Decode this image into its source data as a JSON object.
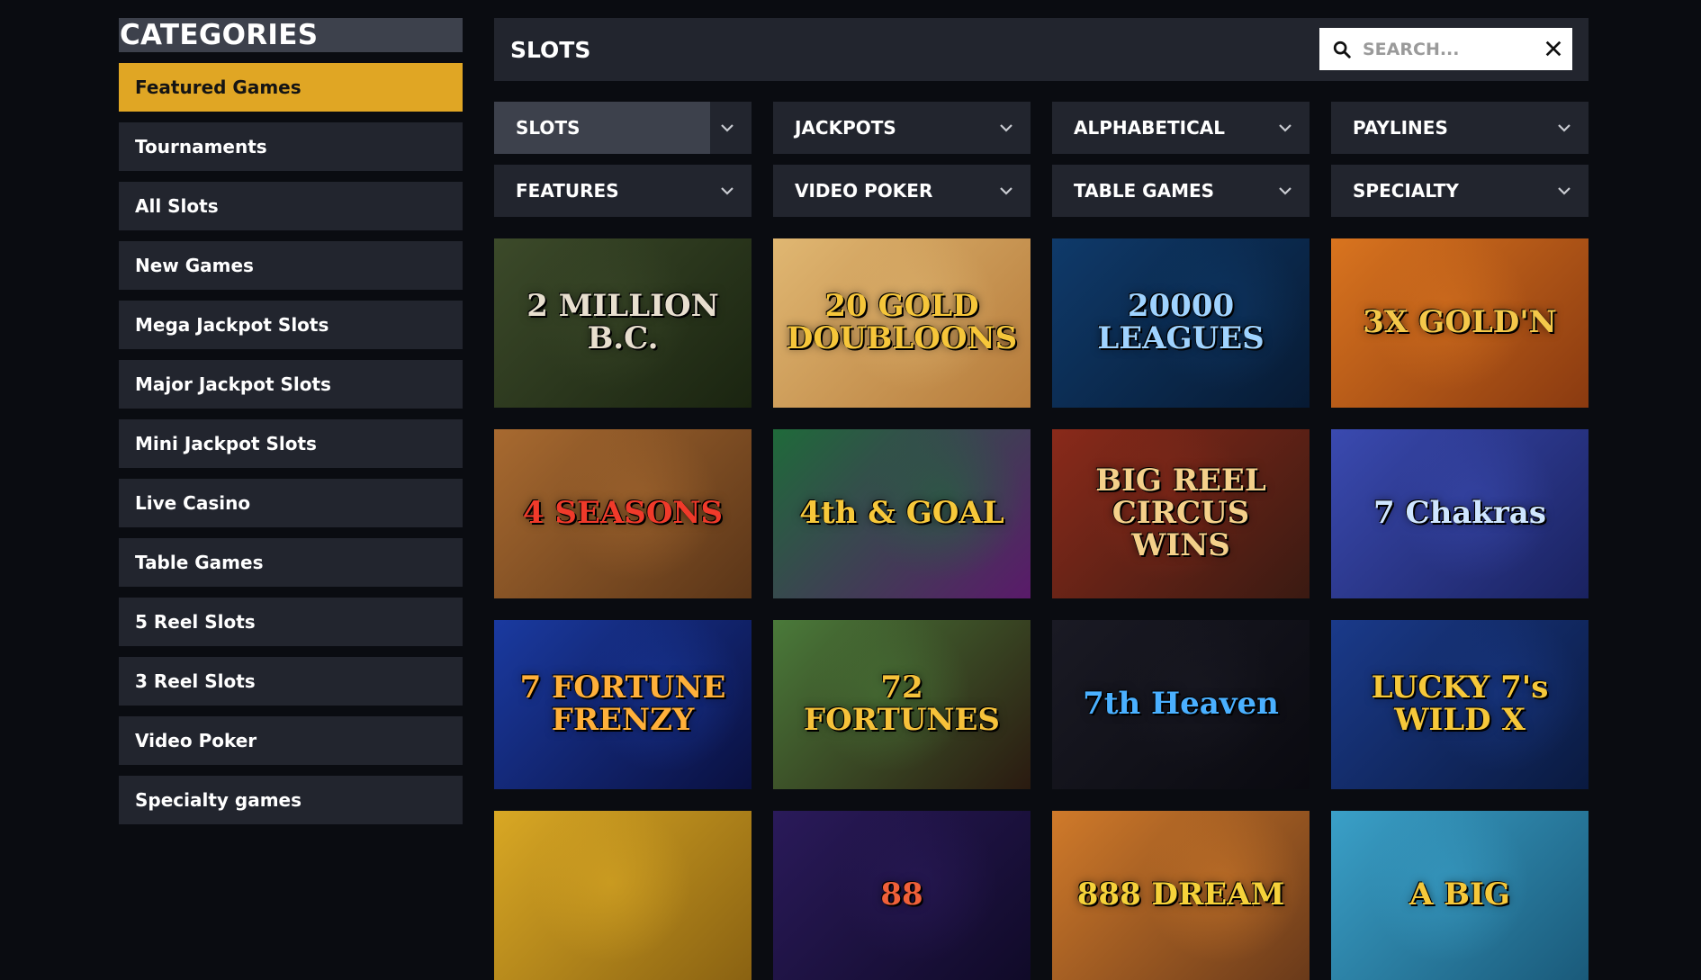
{
  "sidebar": {
    "title": "CATEGORIES",
    "items": [
      {
        "label": "Featured Games",
        "active": true
      },
      {
        "label": "Tournaments"
      },
      {
        "label": "All Slots"
      },
      {
        "label": "New Games"
      },
      {
        "label": "Mega Jackpot Slots"
      },
      {
        "label": "Major Jackpot Slots"
      },
      {
        "label": "Mini Jackpot Slots"
      },
      {
        "label": "Live Casino"
      },
      {
        "label": "Table Games"
      },
      {
        "label": "5 Reel Slots"
      },
      {
        "label": "3 Reel Slots"
      },
      {
        "label": "Video Poker"
      },
      {
        "label": "Specialty games"
      }
    ]
  },
  "header": {
    "title": "SLOTS",
    "search_placeholder": "SEARCH..."
  },
  "filters": [
    {
      "label": "SLOTS",
      "active": true
    },
    {
      "label": "JACKPOTS"
    },
    {
      "label": "ALPHABETICAL"
    },
    {
      "label": "PAYLINES"
    },
    {
      "label": "FEATURES"
    },
    {
      "label": "VIDEO POKER"
    },
    {
      "label": "TABLE GAMES"
    },
    {
      "label": "SPECIALTY"
    }
  ],
  "games": [
    {
      "title": "2 MILLION B.C.",
      "bg": "#3c4a2a",
      "bg2": "#1a2410",
      "fg": "#e8dfcf"
    },
    {
      "title": "20 GOLD DOUBLOONS",
      "bg": "#e0b772",
      "bg2": "#b57a3a",
      "fg": "#f6c63a"
    },
    {
      "title": "20000 LEAGUES",
      "bg": "#0f3a6a",
      "bg2": "#071a33",
      "fg": "#9fd3ff"
    },
    {
      "title": "3X GOLD'N",
      "bg": "#d9741f",
      "bg2": "#8a3a10",
      "fg": "#f4c84a"
    },
    {
      "title": "4 SEASONS",
      "bg": "#a86a30",
      "bg2": "#5a3518",
      "fg": "#f03a2a"
    },
    {
      "title": "4th & GOAL",
      "bg": "#1f6a3a",
      "bg2": "#5a1a6a",
      "fg": "#f7c83a"
    },
    {
      "title": "BIG REEL CIRCUS WINS",
      "bg": "#8a2a1a",
      "bg2": "#3a1a12",
      "fg": "#f4d08a"
    },
    {
      "title": "7 Chakras",
      "bg": "#3a4ab0",
      "bg2": "#1a2260",
      "fg": "#cfe6ff"
    },
    {
      "title": "7 FORTUNE FRENZY",
      "bg": "#1a3aa0",
      "bg2": "#0a1040",
      "fg": "#ffb03a"
    },
    {
      "title": "72 FORTUNES",
      "bg": "#4a7a3a",
      "bg2": "#2a1a10",
      "fg": "#f6c23a"
    },
    {
      "title": "7th Heaven",
      "bg": "#1a1a24",
      "bg2": "#0a0a10",
      "fg": "#4ab0ff"
    },
    {
      "title": "LUCKY 7's WILD X",
      "bg": "#1a3a8a",
      "bg2": "#0a1a40",
      "fg": "#f6c83a"
    },
    {
      "title": "",
      "bg": "#d9a824",
      "bg2": "#8a6212",
      "fg": "#ffffff"
    },
    {
      "title": "88",
      "bg": "#2a1a5a",
      "bg2": "#100a28",
      "fg": "#f0603a"
    },
    {
      "title": "888 DREAM",
      "bg": "#d07a2a",
      "bg2": "#6a3a1a",
      "fg": "#f6d23a"
    },
    {
      "title": "A BIG",
      "bg": "#3aa0c8",
      "bg2": "#1a5a7a",
      "fg": "#f6c83a"
    }
  ],
  "icons": {
    "search": "search-icon",
    "close": "close-icon",
    "chevron": "chevron-down-icon"
  },
  "colors": {
    "accent": "#e0a624",
    "panel": "#22252e",
    "background": "#0a0c11"
  }
}
